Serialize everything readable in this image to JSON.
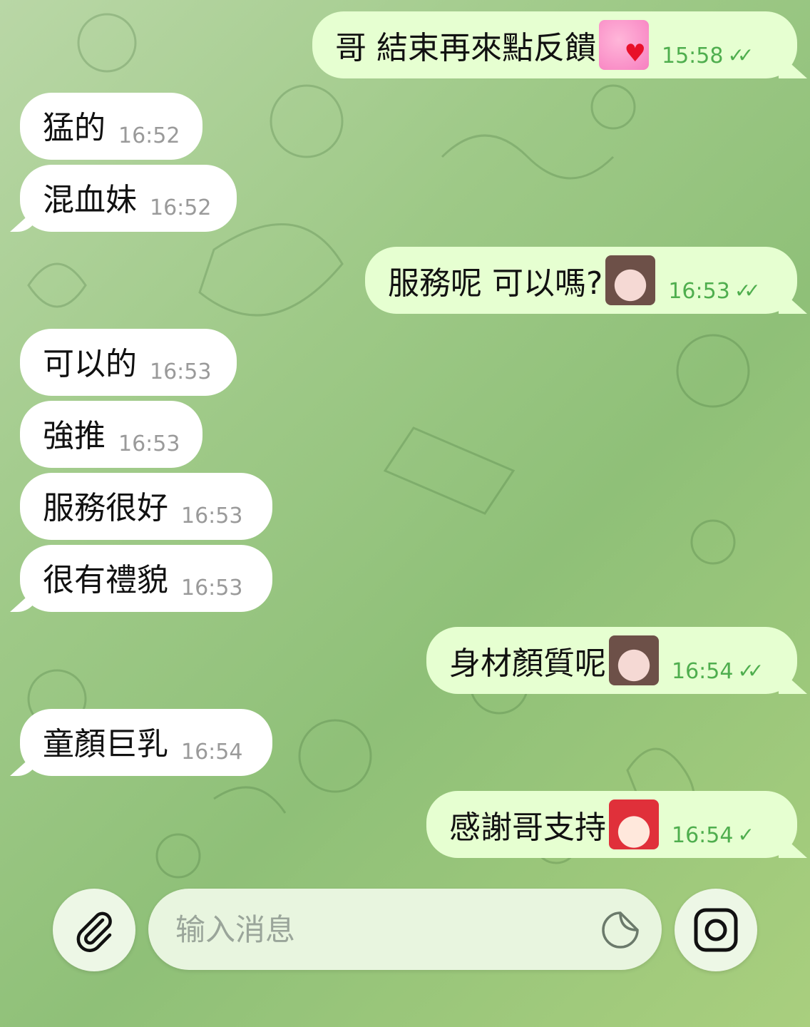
{
  "messages": [
    {
      "dir": "out",
      "text": "哥 結束再來點反饋",
      "time": "15:58",
      "status": "read",
      "emoji": "cat-heart-icon"
    },
    {
      "dir": "in",
      "text": "猛的",
      "time": "16:52"
    },
    {
      "dir": "in",
      "text": "混血妹",
      "time": "16:52"
    },
    {
      "dir": "out",
      "text": "服務呢 可以嗎?",
      "time": "16:53",
      "status": "read",
      "emoji": "anime-girl-sticker-icon"
    },
    {
      "dir": "in",
      "text": "可以的",
      "time": "16:53"
    },
    {
      "dir": "in",
      "text": "強推",
      "time": "16:53"
    },
    {
      "dir": "in",
      "text": "服務很好",
      "time": "16:53"
    },
    {
      "dir": "in",
      "text": "很有禮貌",
      "time": "16:53"
    },
    {
      "dir": "out",
      "text": "身材顏質呢",
      "time": "16:54",
      "status": "read",
      "emoji": "anime-girl-sticker-icon"
    },
    {
      "dir": "in",
      "text": "童顏巨乳",
      "time": "16:54"
    },
    {
      "dir": "out",
      "text": "感謝哥支持",
      "time": "16:54",
      "status": "sent",
      "emoji": "red-hair-laughing-icon"
    }
  ],
  "composer": {
    "placeholder": "输入消息",
    "attach_icon": "paperclip-icon",
    "sticker_icon": "sticker-icon",
    "camera_icon": "instagram-camera-icon"
  },
  "colors": {
    "incoming_bubble": "#ffffff",
    "outgoing_bubble": "#e6ffd1",
    "read_check": "#4fae4e"
  }
}
